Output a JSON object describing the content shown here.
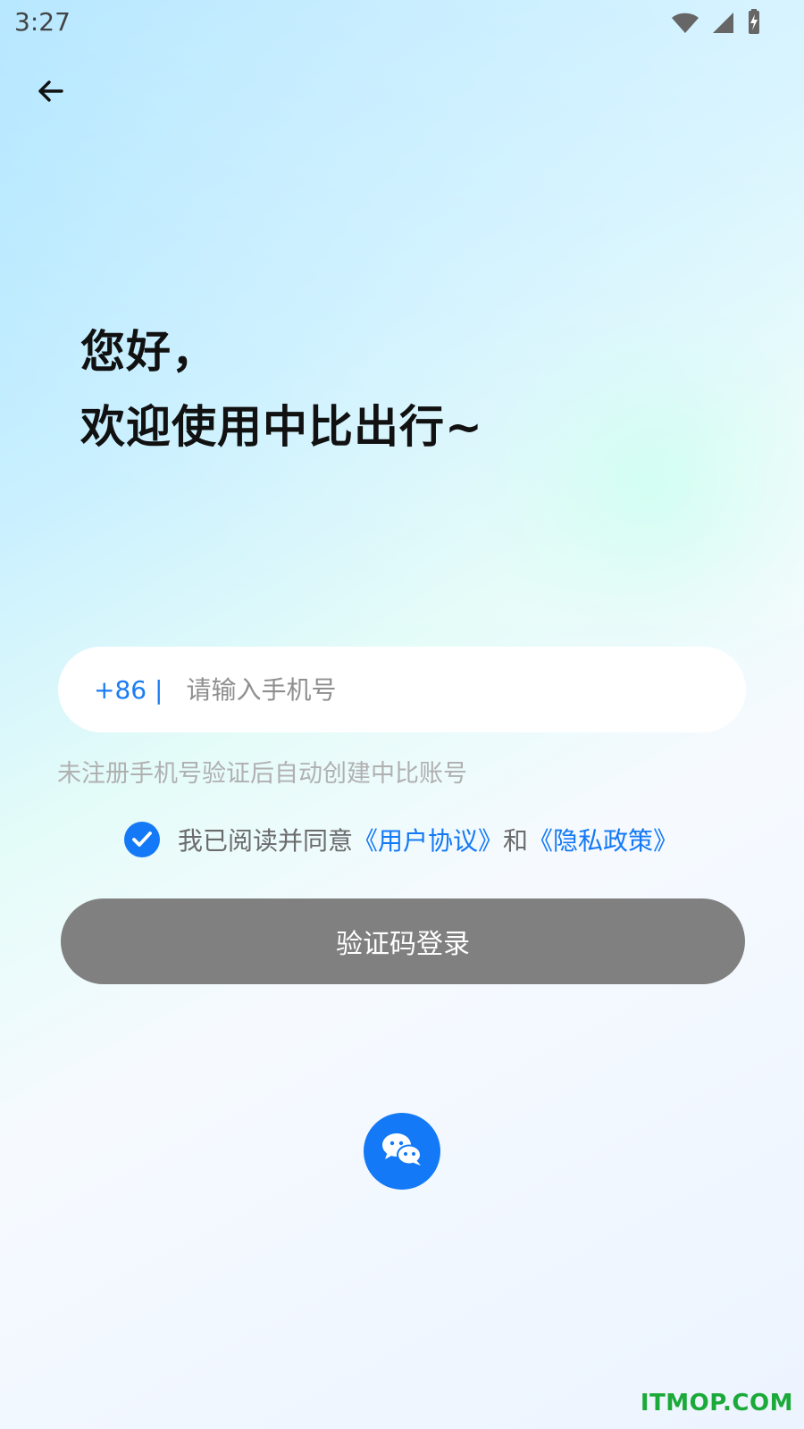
{
  "status_bar": {
    "time": "3:27",
    "icons": [
      "wifi-icon",
      "signal-icon",
      "battery-charging-icon"
    ]
  },
  "header": {
    "back_icon": "back-arrow-icon"
  },
  "welcome": {
    "line1": "您好，",
    "line2": "欢迎使用中比出行~"
  },
  "login_form": {
    "country_code": "+86 |",
    "phone_placeholder": "请输入手机号",
    "tip": "未注册手机号验证后自动创建中比账号",
    "agreement_prefix": "我已阅读并同意",
    "user_agreement": "《用户协议》",
    "and": "和",
    "privacy_policy": "《隐私政策》",
    "checkbox_checked": true,
    "login_button": "验证码登录"
  },
  "social_login": {
    "wechat_icon": "wechat-icon"
  },
  "watermark": {
    "text": "ITMOP.COM"
  },
  "colors": {
    "primary": "#1479F6",
    "disabled_button": "#808080",
    "tip_text": "#B0B0B0"
  }
}
